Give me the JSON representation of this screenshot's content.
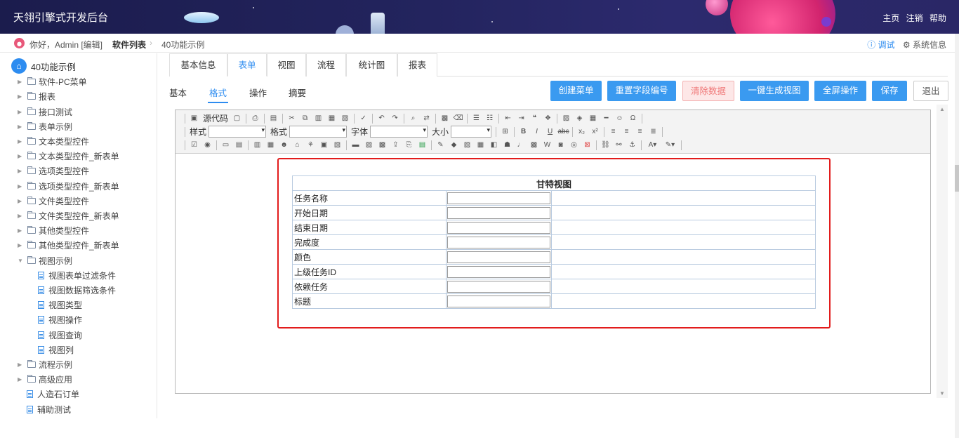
{
  "header": {
    "title": "天翎引擎式开发后台",
    "links": [
      "主页",
      "注销",
      "帮助"
    ]
  },
  "breadcrumb": {
    "greeting": "你好，Admin [编辑]",
    "section": "软件列表",
    "current": "40功能示例",
    "debug": "ⓘ 调试",
    "sysinfo": "⚙ 系统信息"
  },
  "sidebar": {
    "root": "40功能示例",
    "items": [
      {
        "label": "软件-PC菜单"
      },
      {
        "label": "报表"
      },
      {
        "label": "接口测试"
      },
      {
        "label": "表单示例"
      },
      {
        "label": "文本类型控件"
      },
      {
        "label": "文本类型控件_新表单"
      },
      {
        "label": "选项类型控件"
      },
      {
        "label": "选项类型控件_新表单"
      },
      {
        "label": "文件类型控件"
      },
      {
        "label": "文件类型控件_新表单"
      },
      {
        "label": "其他类型控件"
      },
      {
        "label": "其他类型控件_新表单"
      },
      {
        "label": "视图示例"
      },
      {
        "label": "视图表单过滤条件"
      },
      {
        "label": "视图数据筛选条件"
      },
      {
        "label": "视图类型"
      },
      {
        "label": "视图操作"
      },
      {
        "label": "视图查询"
      },
      {
        "label": "视图列"
      },
      {
        "label": "流程示例"
      },
      {
        "label": "高级应用"
      },
      {
        "label": "人造石订单"
      },
      {
        "label": "辅助测试"
      }
    ]
  },
  "tabs": [
    "基本信息",
    "表单",
    "视图",
    "流程",
    "统计图",
    "报表"
  ],
  "subtabs": [
    "基本",
    "格式",
    "操作",
    "摘要"
  ],
  "actions": {
    "create_menu": "创建菜单",
    "reset_fields": "重置字段编号",
    "clear_data": "清除数据",
    "gen_view": "一键生成视图",
    "fullscreen": "全屏操作",
    "save": "保存",
    "exit": "退出"
  },
  "toolbar": {
    "source": "源代码",
    "style_label": "样式",
    "format_label": "格式",
    "font_label": "字体",
    "size_label": "大小"
  },
  "gantt_form": {
    "title": "甘特视图",
    "fields": [
      "任务名称",
      "开始日期",
      "结束日期",
      "完成度",
      "颜色",
      "上级任务ID",
      "依赖任务",
      "标题"
    ]
  }
}
